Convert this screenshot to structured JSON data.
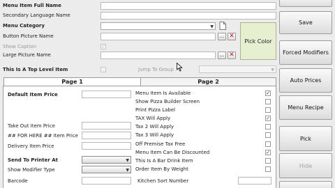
{
  "form": {
    "menu_item_full_name": "Menu Item Full Name",
    "secondary_language_name": "Secondary Language Name",
    "menu_category": "Menu Category",
    "button_picture_name": "Button Picture Name",
    "show_caption": "Show Caption",
    "large_picture_name": "Large Picture Name",
    "top_level_item": "This Is A Top Level Item",
    "jump_to_group": "Jump To Group",
    "browse_label": "...",
    "pick_color": "Pick Color"
  },
  "tabs": [
    {
      "label": "Page 1",
      "active": true
    },
    {
      "label": "Page 2",
      "active": false
    }
  ],
  "page1": {
    "default_item_price": "Default Item Price",
    "take_out_item_price": "Take Out Item Price",
    "for_here_item_price": "## FOR HERE ## Item Price",
    "delivery_item_price": "Delivery Item Price",
    "send_to_printer_at": "Send To Printer At",
    "show_modifier_type": "Show Modifier Type",
    "barcode": "Barcode",
    "kitchen_sort_number": "Kitchen Sort Number",
    "checkboxes": [
      {
        "label": "Menu Item Is Available",
        "checked": true
      },
      {
        "label": "Show Pizza Builder Screen",
        "checked": false
      },
      {
        "label": "Print Pizza Label",
        "checked": false
      },
      {
        "label": "TAX Will Apply",
        "checked": true
      },
      {
        "label": "Tax 2 Will Apply",
        "checked": false
      },
      {
        "label": "Tax 3 Will Apply",
        "checked": false
      },
      {
        "label": "Off Premise Tax Free",
        "checked": false
      },
      {
        "label": "Menu Item Can Be Discounted",
        "checked": true
      },
      {
        "label": "This Is A Bar Drink Item",
        "checked": false
      },
      {
        "label": "Order Item By Weight",
        "checked": false
      }
    ]
  },
  "right_buttons": {
    "save": "Save",
    "forced_modifiers": "Forced Modifiers",
    "auto_prices": "Auto Prices",
    "menu_recipe": "Menu Recipe",
    "pick": "Pick",
    "hide": "Hide"
  },
  "colors": {
    "background": "#ececec",
    "pick_color_swatch": "#e6efcf",
    "delete_icon": "#c21010",
    "check_blue": "#1a4fb8"
  },
  "icons": {
    "browse": "ellipsis",
    "delete": "red-x-icon",
    "combo_arrow": "chevron-down-icon",
    "checkbox_mark": "check-icon"
  }
}
